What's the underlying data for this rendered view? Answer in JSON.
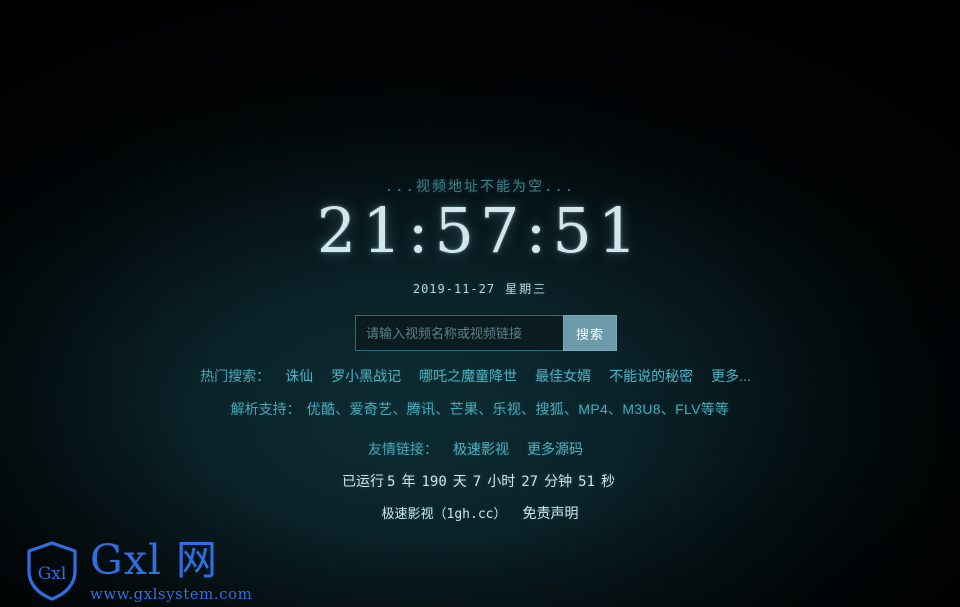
{
  "colors": {
    "accent_teal": "#4fb0bf",
    "label_teal": "#49a3b2",
    "status_teal": "#3f7d87",
    "clock_text": "#d3e6ec",
    "button_bg": "#6c9aa9",
    "input_border": "#2b6c7b",
    "watermark_blue": "#2f6fe0",
    "background_dark": "#02090b"
  },
  "status": {
    "message": "...视频地址不能为空..."
  },
  "clock": {
    "time": "21:57:51",
    "date": "2019-11-27",
    "weekday": "星期三"
  },
  "search": {
    "value": "",
    "placeholder": "请输入视频名称或视频链接",
    "button_label": "搜索"
  },
  "hot_search": {
    "label": "热门搜索：",
    "items": [
      "诛仙",
      "罗小黑战记",
      "哪吒之魔童降世",
      "最佳女婿",
      "不能说的秘密",
      "更多..."
    ]
  },
  "parse_support": {
    "label": "解析支持：",
    "text": "优酷、爱奇艺、腾讯、芒果、乐视、搜狐、MP4、M3U8、FLV等等"
  },
  "friend_links": {
    "label": "友情链接：",
    "items": [
      "极速影视",
      "更多源码"
    ]
  },
  "uptime": {
    "prefix": "已运行",
    "years": "5",
    "years_unit": "年",
    "days": "190",
    "days_unit": "天",
    "hours": "7",
    "hours_unit": "小时",
    "minutes": "27",
    "minutes_unit": "分钟",
    "seconds": "51",
    "seconds_unit": "秒"
  },
  "footer": {
    "site_name": "极速影视（1gh.cc）",
    "disclaimer": "免责声明"
  },
  "watermark": {
    "shield_label": "Gxl",
    "title": "Gxl 网",
    "url": "www.gxlsystem.com"
  }
}
